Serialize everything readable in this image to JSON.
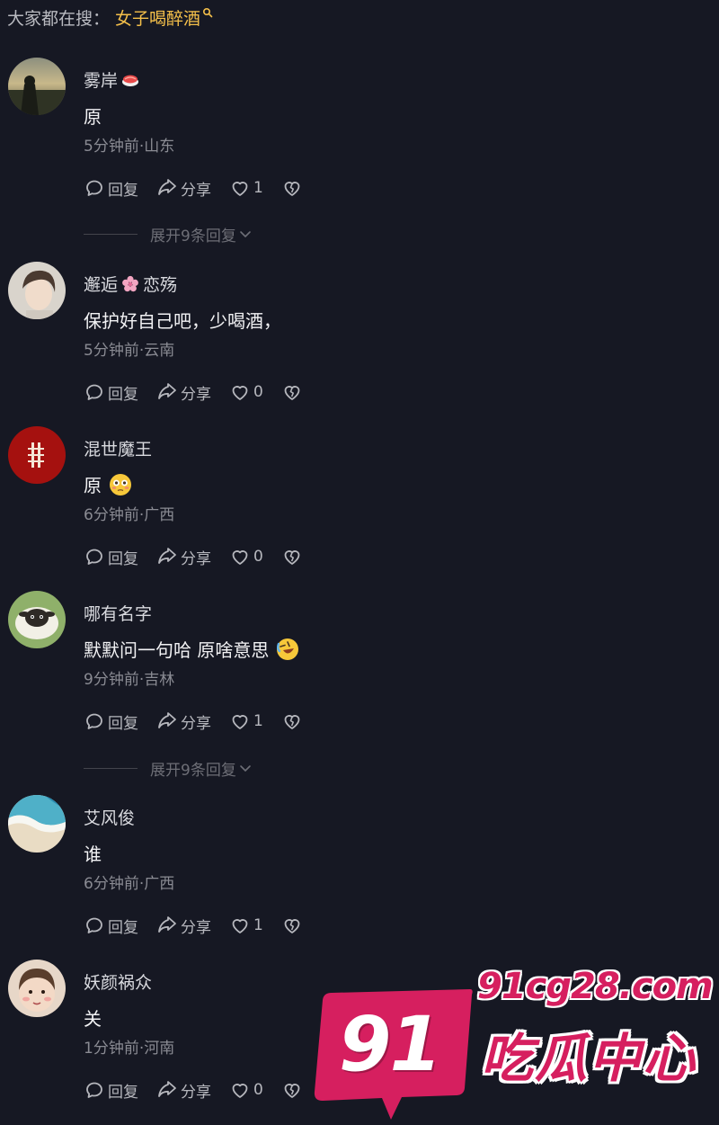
{
  "search_hint": {
    "prefix": "大家都在搜：",
    "term": "女子喝醉酒"
  },
  "actions": {
    "reply_label": "回复",
    "share_label": "分享"
  },
  "expand_label": "展开9条回复",
  "comments": [
    {
      "username": "雾岸",
      "content": "原",
      "meta": "5分钟前·山东",
      "likes": "1"
    },
    {
      "username_part1": "邂逅",
      "username_part2": "恋殇",
      "content": "保护好自己吧，少喝酒，",
      "meta": "5分钟前·云南",
      "likes": "0"
    },
    {
      "username": "混世魔王",
      "content": "原",
      "meta": "6分钟前·广西",
      "likes": "0"
    },
    {
      "username": "哪有名字",
      "content": "默默问一句哈 原啥意思",
      "meta": "9分钟前·吉林",
      "likes": "1"
    },
    {
      "username": "艾风俊",
      "content": "谁",
      "meta": "6分钟前·广西",
      "likes": "1"
    },
    {
      "username": "妖颜祸众",
      "content": "关",
      "meta": "1分钟前·河南",
      "likes": "0"
    }
  ],
  "watermark": {
    "badge": "91",
    "domain": "91cg28.com",
    "brand": "吃瓜中心"
  },
  "colors": {
    "background": "#161823",
    "search_term": "#f5c04a",
    "watermark": "#d61f5f"
  }
}
